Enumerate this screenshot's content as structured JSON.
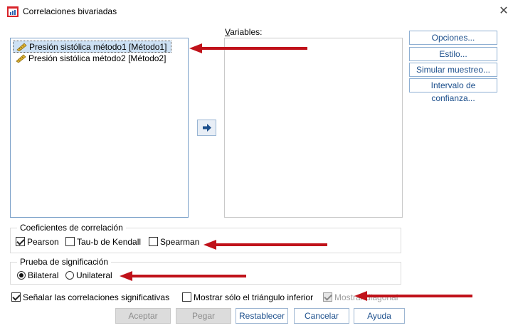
{
  "window": {
    "title": "Correlaciones bivariadas",
    "close_glyph": "✕"
  },
  "source_list": {
    "items": [
      {
        "label": "Presión sistólica método1 [Método1]",
        "selected": true
      },
      {
        "label": "Presión sistólica método2 [Método2]",
        "selected": false
      }
    ]
  },
  "variables": {
    "label_u": "V",
    "label_rest": "ariables:",
    "items": []
  },
  "move_button": {
    "icon": "right-arrow-icon"
  },
  "side_buttons": {
    "opciones": "Opciones...",
    "estilo": "Estilo...",
    "simular": "Simular muestreo...",
    "intervalo": "Intervalo de confianza..."
  },
  "coefficients": {
    "title": "Coeficientes de correlación",
    "pearson": {
      "label": "Pearson",
      "checked": true
    },
    "kendall": {
      "label": "Tau-b de Kendall",
      "checked": false
    },
    "spearman": {
      "label": "Spearman",
      "checked": false
    }
  },
  "significance": {
    "title": "Prueba de significación",
    "bilateral": {
      "label": "Bilateral",
      "selected": true
    },
    "unilateral": {
      "label": "Unilateral",
      "selected": false
    }
  },
  "options": {
    "flag_significant": {
      "label": "Señalar las correlaciones significativas",
      "checked": true
    },
    "lower_triangle": {
      "label": "Mostrar sólo el triángulo inferior",
      "checked": false
    },
    "show_diagonal": {
      "label": "Mostrar diagonal",
      "checked": true,
      "disabled": true
    }
  },
  "buttons": {
    "aceptar": "Aceptar",
    "pegar": "Pegar",
    "restablecer": "Restablecer",
    "cancelar": "Cancelar",
    "ayuda": "Ayuda"
  },
  "colors": {
    "annotation_arrow": "#c0121a",
    "accent": "#1c4f8c",
    "selection": "#cde1f4"
  }
}
